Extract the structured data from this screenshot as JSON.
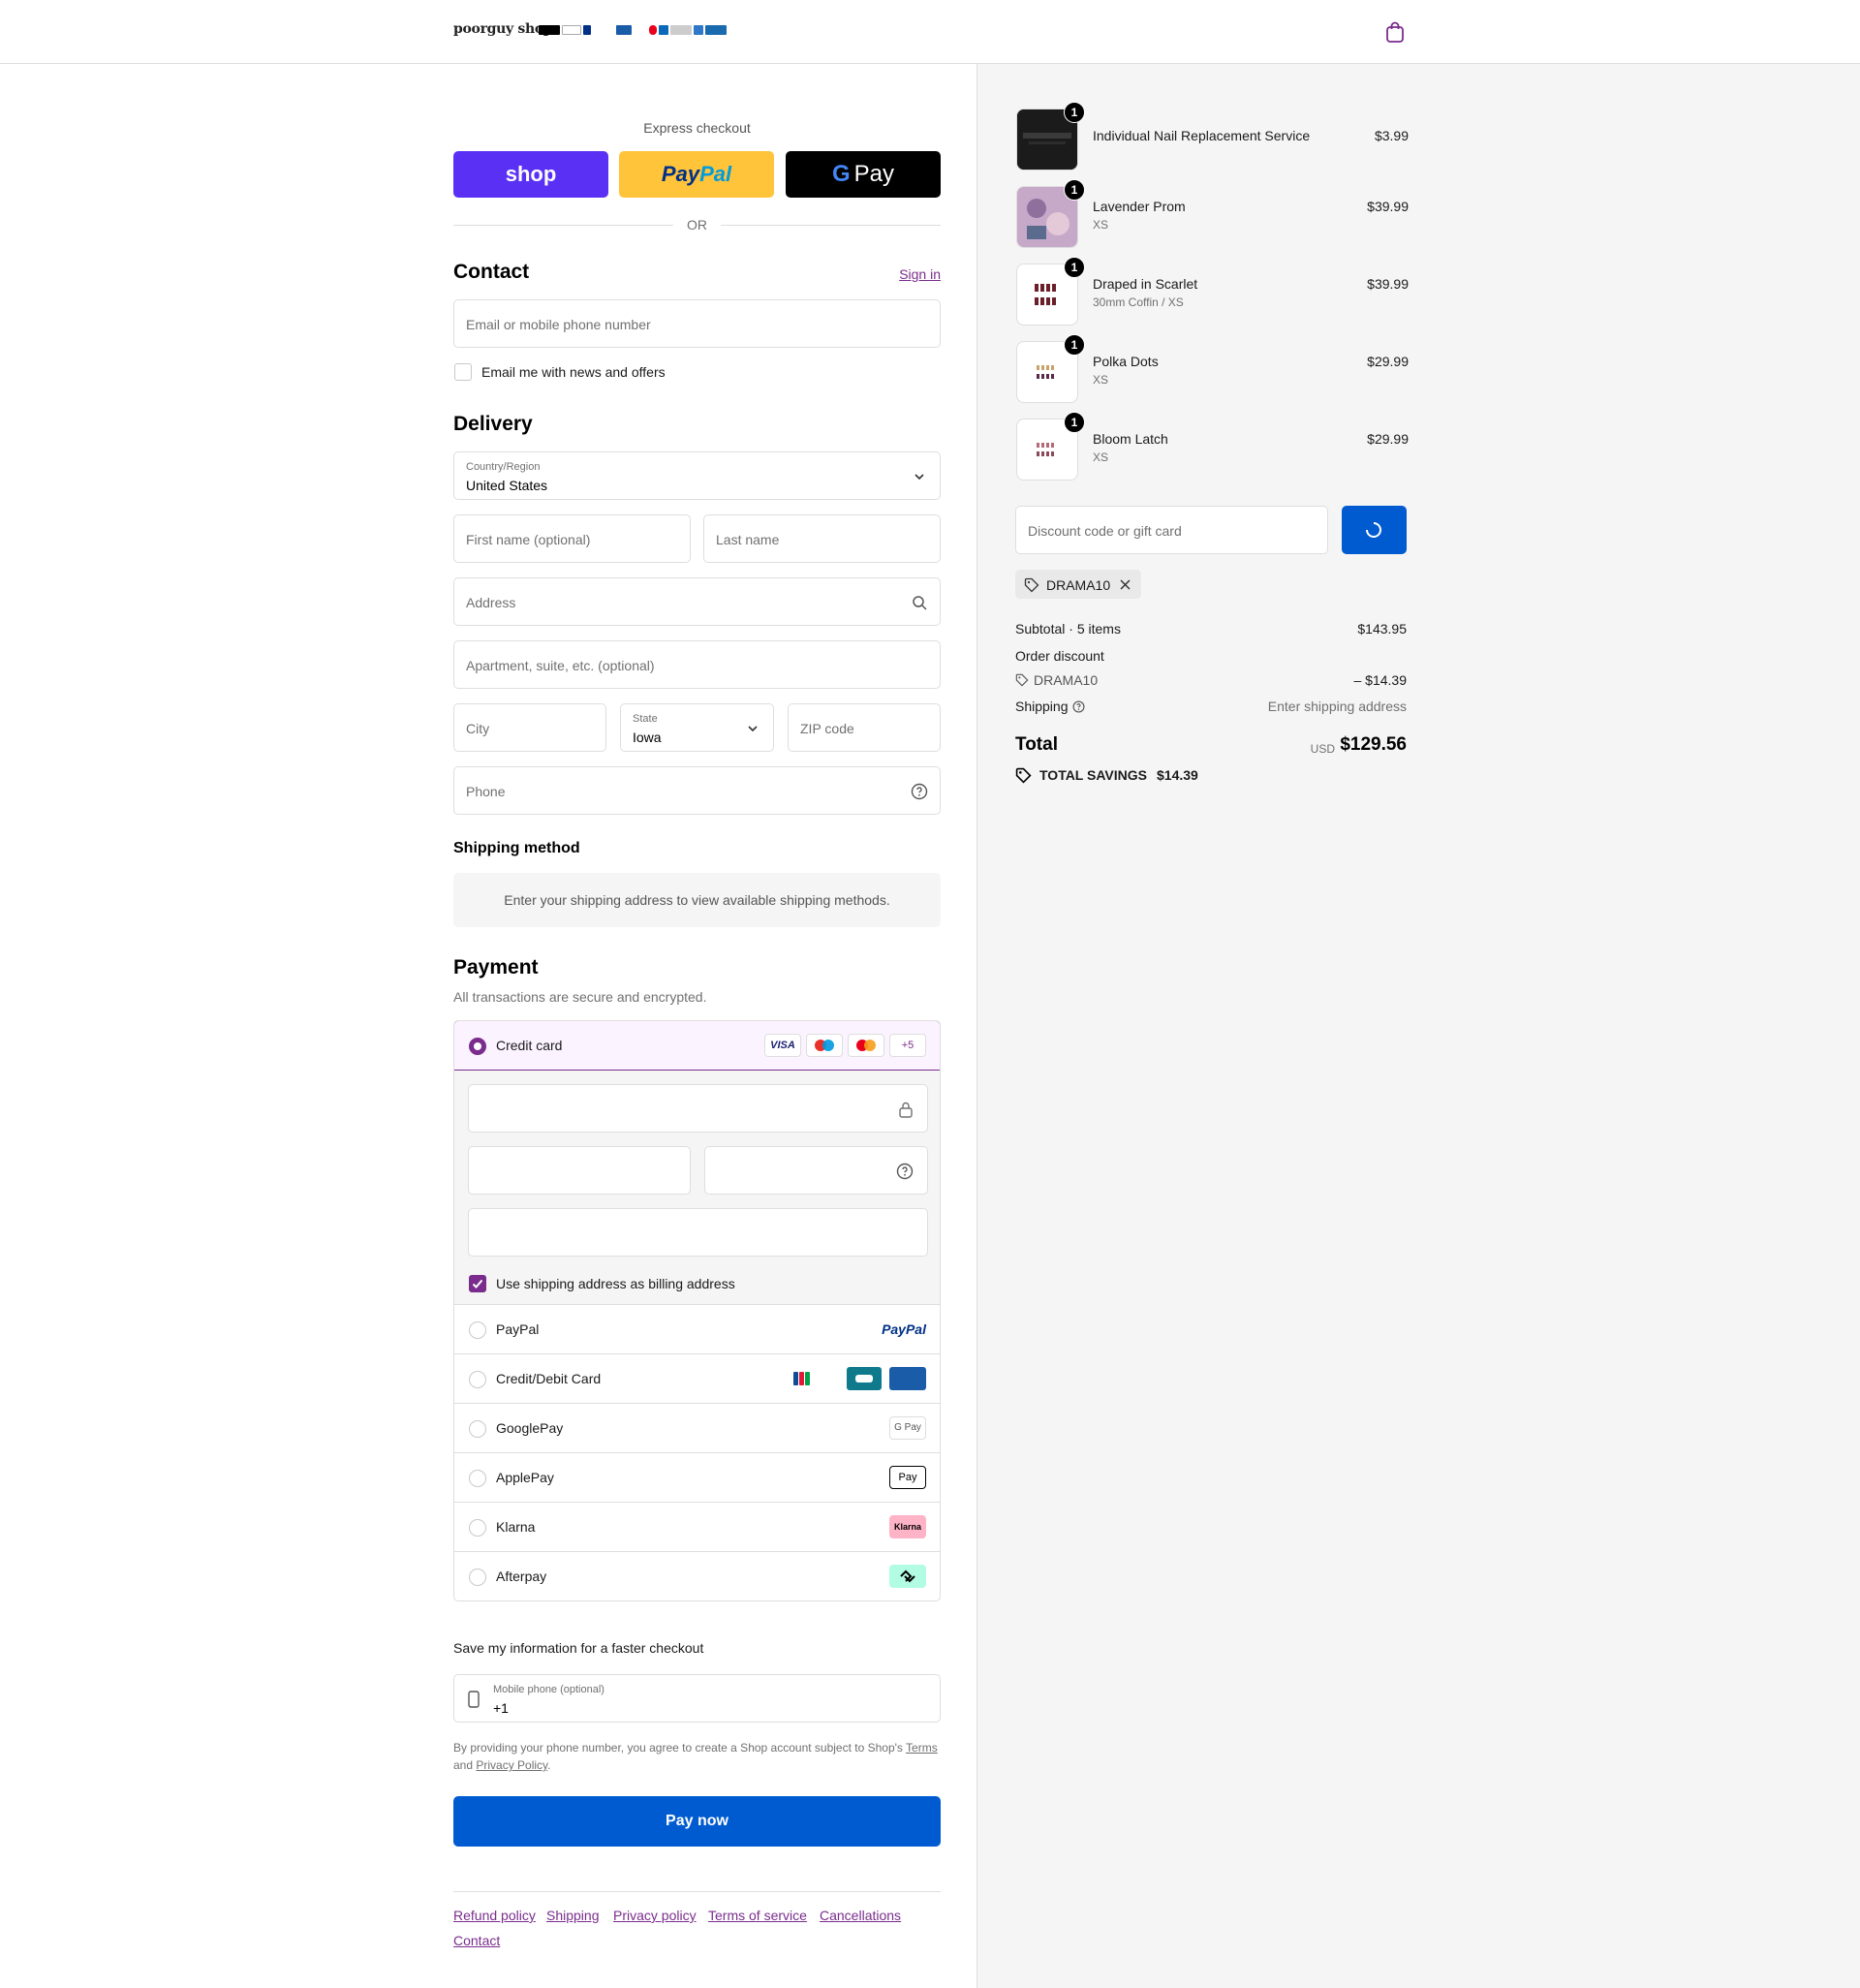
{
  "header": {
    "logo": "poorguy shop",
    "payment_strip": [
      "Pay",
      "G Pay",
      "P",
      "PayPal",
      "",
      "VISA",
      "",
      "",
      "",
      "",
      ""
    ]
  },
  "express": {
    "label": "Express checkout",
    "shop_label": "shop",
    "paypal_label_1": "Pay",
    "paypal_label_2": "Pal",
    "gpay_g": "G",
    "gpay_label": "Pay",
    "or": "OR"
  },
  "contact": {
    "title": "Contact",
    "sign_in": "Sign in",
    "email_placeholder": "Email or mobile phone number",
    "news_label": "Email me with news and offers"
  },
  "delivery": {
    "title": "Delivery",
    "country_label": "Country/Region",
    "country_value": "United States",
    "first_name": "First name (optional)",
    "last_name": "Last name",
    "address": "Address",
    "apartment": "Apartment, suite, etc. (optional)",
    "city": "City",
    "state_label": "State",
    "state_value": "Iowa",
    "zip": "ZIP code",
    "phone": "Phone"
  },
  "shipping_method": {
    "title": "Shipping method",
    "message": "Enter your shipping address to view available shipping methods."
  },
  "payment": {
    "title": "Payment",
    "subtitle": "All transactions are secure and encrypted.",
    "credit_card": "Credit card",
    "card_badges": [
      "VISA",
      "",
      "",
      "+5"
    ],
    "billing_same": "Use shipping address as billing address",
    "methods": [
      {
        "label": "PayPal",
        "badge": "PayPal"
      },
      {
        "label": "Credit/Debit Card",
        "badge": ""
      },
      {
        "label": "GooglePay",
        "badge": "G Pay"
      },
      {
        "label": "ApplePay",
        "badge": "Pay"
      },
      {
        "label": "Klarna",
        "badge": "Klarna"
      },
      {
        "label": "Afterpay",
        "badge": ""
      }
    ]
  },
  "save_info": {
    "title": "Save my information for a faster checkout",
    "mobile_label": "Mobile phone (optional)",
    "mobile_value": "+1",
    "legal_1": "By providing your phone number, you agree to create a Shop account subject to Shop's",
    "terms": "Terms",
    "legal_and": "and",
    "privacy": "Privacy Policy",
    "legal_end": "."
  },
  "pay_now": "Pay now",
  "footer": [
    "Refund policy",
    "Shipping",
    "Privacy policy",
    "Terms of service",
    "Cancellations",
    "Contact"
  ],
  "cart": {
    "items": [
      {
        "name": "Individual Nail Replacement Service",
        "variant": "",
        "price": "$3.99",
        "qty": "1"
      },
      {
        "name": "Lavender Prom",
        "variant": "XS",
        "price": "$39.99",
        "qty": "1"
      },
      {
        "name": "Draped in Scarlet",
        "variant": "30mm Coffin / XS",
        "price": "$39.99",
        "qty": "1"
      },
      {
        "name": "Polka Dots",
        "variant": "XS",
        "price": "$29.99",
        "qty": "1"
      },
      {
        "name": "Bloom Latch",
        "variant": "XS",
        "price": "$29.99",
        "qty": "1"
      }
    ],
    "discount_placeholder": "Discount code or gift card",
    "applied_code": "DRAMA10",
    "subtotal_label": "Subtotal · 5 items",
    "subtotal_value": "$143.95",
    "order_discount_label": "Order discount",
    "discount_code": "DRAMA10",
    "discount_value": "– $14.39",
    "shipping_label": "Shipping",
    "shipping_value": "Enter shipping address",
    "total_label": "Total",
    "currency": "USD",
    "total_value": "$129.56",
    "savings_label": "TOTAL SAVINGS",
    "savings_value": "$14.39"
  },
  "colors": {
    "accent": "#7a2d8c",
    "primary_button": "#005bd1",
    "shop_pay": "#5a31f4",
    "paypal": "#ffc439"
  }
}
